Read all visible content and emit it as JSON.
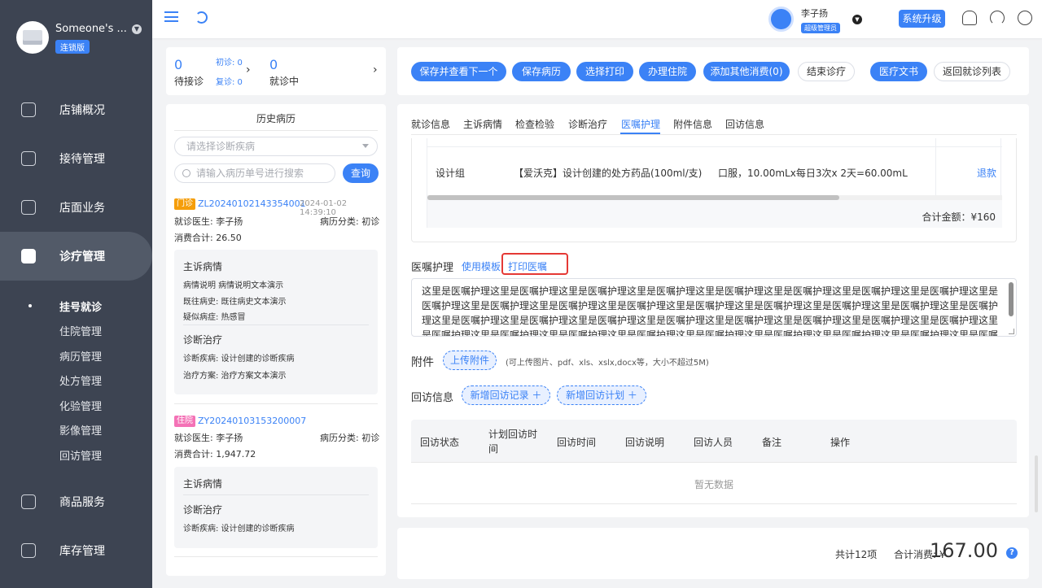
{
  "brand": {
    "name": "Someone's ...",
    "badge": "连锁版"
  },
  "sidebar": {
    "items": [
      {
        "label": "店铺概况"
      },
      {
        "label": "接待管理"
      },
      {
        "label": "店面业务"
      },
      {
        "label": "诊疗管理"
      },
      {
        "label": "商品服务"
      },
      {
        "label": "库存管理"
      }
    ],
    "sub_items": [
      "挂号就诊",
      "住院管理",
      "病历管理",
      "处方管理",
      "化验管理",
      "影像管理",
      "回访管理"
    ]
  },
  "topbar": {
    "user_name": "李子扬",
    "user_role": "超级管理员",
    "upgrade_label": "系统升级"
  },
  "queue": {
    "waiting_count": "0",
    "waiting_label": "待接诊",
    "first_visit": "初诊: 0",
    "return_visit": "复诊: 0",
    "in_progress_count": "0",
    "in_progress_label": "就诊中"
  },
  "history": {
    "title": "历史病历",
    "select_placeholder": "请选择诊断疾病",
    "search_placeholder": "请输入病历单号进行搜索",
    "query_label": "查询",
    "records": [
      {
        "type": "门诊",
        "type_color": "#f59e0b",
        "no": "ZL20240102143354001",
        "time": "2024-01-02 14:39:10",
        "doctor": "就诊医生: 李子扬",
        "category": "病历分类: 初诊",
        "cost": "消费合计: 26.50",
        "complaint_title": "主诉病情",
        "complaint_lines": [
          "病情说明  病情说明文本演示",
          "既往病史:  既往病史文本演示",
          "疑似病症:  热感冒"
        ],
        "diag_title": "诊断治疗",
        "diag_lines": [
          "诊断疾病:  设计创建的诊断疾病",
          "治疗方案:  治疗方案文本演示"
        ]
      },
      {
        "type": "住院",
        "type_color": "#f472b6",
        "no": "ZY20240103153200007",
        "doctor": "就诊医生: 李子扬",
        "category": "病历分类: 初诊",
        "cost": "消费合计: 1,947.72",
        "complaint_title": "主诉病情",
        "diag_title": "诊断治疗",
        "diag_lines": [
          "诊断疾病:  设计创建的诊断疾病"
        ]
      }
    ]
  },
  "actions": {
    "buttons": [
      {
        "label": "保存并查看下一个",
        "style": "primary"
      },
      {
        "label": "保存病历",
        "style": "primary"
      },
      {
        "label": "选择打印",
        "style": "primary"
      },
      {
        "label": "办理住院",
        "style": "primary"
      },
      {
        "label": "添加其他消费(0)",
        "style": "primary"
      },
      {
        "label": "结束诊疗",
        "style": "outline"
      },
      {
        "label": "医疗文书",
        "style": "primary"
      },
      {
        "label": "返回就诊列表",
        "style": "outline"
      }
    ]
  },
  "tabs": [
    "就诊信息",
    "主诉病情",
    "检查检验",
    "诊断治疗",
    "医嘱护理",
    "附件信息",
    "回访信息"
  ],
  "prescription": {
    "group": "设计组",
    "drug": "【爱沃克】设计创建的处方药品(100ml/支)",
    "usage": "口服，10.00mLx每日3次x 2天=60.00mL",
    "refund_label": "退款",
    "total": "合计金额：¥160"
  },
  "nursing": {
    "label": "医嘱护理",
    "use_template": "使用模板",
    "print_label": "打印医嘱",
    "text": "这里是医嘱护理这里是医嘱护理这里是医嘱护理这里是医嘱护理这里是医嘱护理这里是医嘱护理这里是医嘱护理这里是医嘱护理这里是医嘱护理这里是医嘱护理这里是医嘱护理这里是医嘱护理这里是医嘱护理这里是医嘱护理这里是医嘱护理这里是医嘱护理这里是医嘱护理这里是医嘱护理这里是医嘱护理这里是医嘱护理这里是医嘱护理这里是医嘱护理这里是医嘱护理这里是医嘱护理这里是医嘱护理这里是医嘱护理这里是医嘱护理这里是医嘱护理这里是医嘱护理这里是医嘱护理这里是医嘱护理这里是医嘱护理这里是医嘱护理这里是医嘱护理这里是医嘱护理这里是医嘱护理"
  },
  "attachment": {
    "label": "附件",
    "upload_label": "上传附件",
    "hint": "(可上传图片、pdf、xls、xslx,docx等，大小不超过5M)"
  },
  "followup": {
    "label": "回访信息",
    "add_record": "新增回访记录 ＋",
    "add_plan": "新增回访计划 ＋",
    "columns": [
      "回访状态",
      "计划回访时间",
      "回访时间",
      "回访说明",
      "回访人员",
      "备注",
      "操作"
    ],
    "empty": "暂无数据"
  },
  "footer": {
    "count": "共计12项",
    "total_label": "合计消费: ¥",
    "total": "167.00"
  }
}
